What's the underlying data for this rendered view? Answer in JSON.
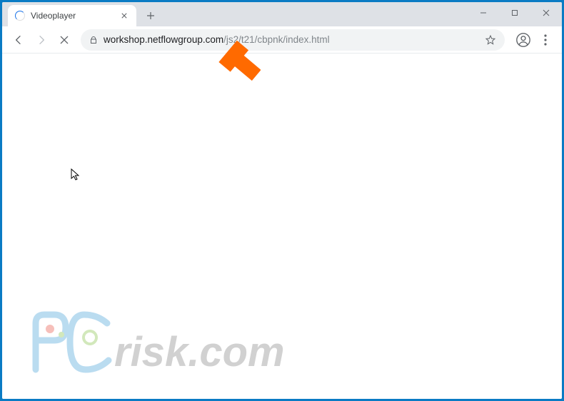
{
  "window": {
    "tab_title": "Videoplayer",
    "minimize_tip": "Minimize",
    "maximize_tip": "Maximize",
    "close_tip": "Close"
  },
  "toolbar": {
    "back_tip": "Back",
    "forward_tip": "Forward",
    "stop_tip": "Stop",
    "url_domain": "workshop.netflowgroup.com",
    "url_path": "/js2/t21/cbpnk/index.html"
  },
  "watermark": {
    "prefix": "PC",
    "suffix": "risk.com"
  },
  "colors": {
    "accent": "#1a73e8",
    "titlebar_bg": "#dee1e6",
    "omnibox_bg": "#f1f3f4",
    "url_path": "#80868b",
    "annotation_arrow": "#ff6a00",
    "watermark_blue": "#3c9cd7",
    "watermark_gray": "#7d7d7d",
    "watermark_green": "#7fbf3f",
    "frame": "#0a7bc4"
  }
}
